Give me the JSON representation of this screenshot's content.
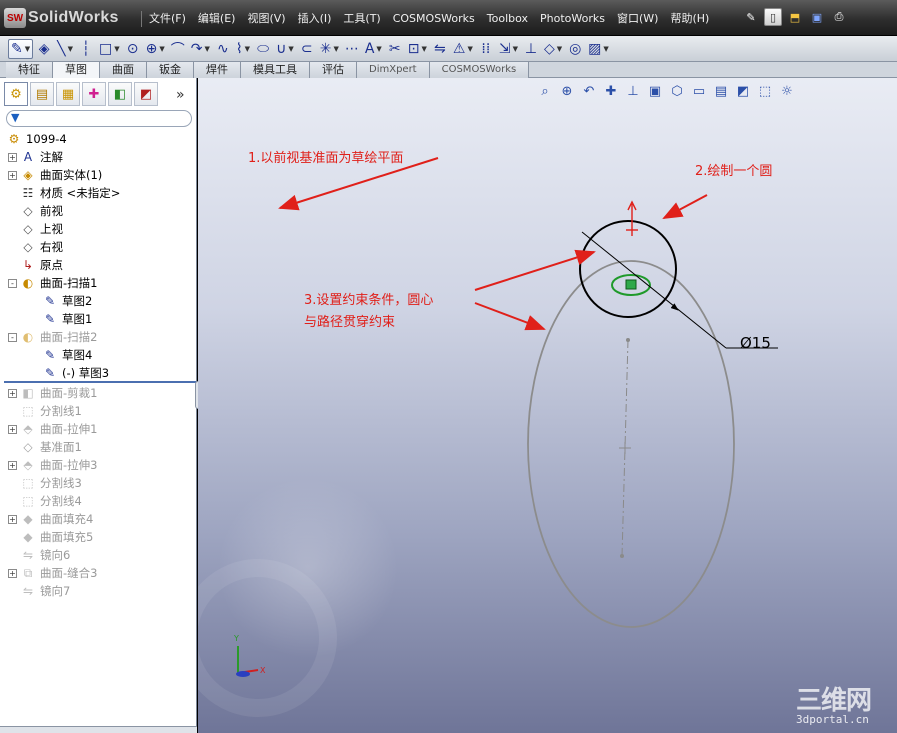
{
  "app": {
    "logo_badge": "SW",
    "name": "SolidWorks"
  },
  "menu": [
    "文件(F)",
    "编辑(E)",
    "视图(V)",
    "插入(I)",
    "工具(T)",
    "COSMOSWorks",
    "Toolbox",
    "PhotoWorks",
    "窗口(W)",
    "帮助(H)"
  ],
  "title_tools": [
    "pushpin-icon",
    "new-document-icon",
    "open-icon",
    "save-icon",
    "print-icon"
  ],
  "sketch_tools": [
    "sketch-icon",
    "smart-dimension-icon",
    "line-icon",
    "centerline-icon",
    "rectangle-icon",
    "circle-icon",
    "circle-perimeter-icon",
    "arc-icon",
    "tangent-arc-icon",
    "spline-icon",
    "convert-spline-icon",
    "ellipse-icon",
    "parabola-icon",
    "partial-ellipse-icon",
    "point-icon",
    "grid-icon",
    "text-icon",
    "trim-icon",
    "offset-icon",
    "mirror-icon",
    "warning-icon",
    "linear-pattern-icon",
    "move-entities-icon",
    "display-relations-icon",
    "repair-icon",
    "rapid-sketch-icon",
    "sketch-picture-icon"
  ],
  "tabs": [
    {
      "label": "特征",
      "active": false
    },
    {
      "label": "草图",
      "active": true
    },
    {
      "label": "曲面",
      "active": false
    },
    {
      "label": "钣金",
      "active": false
    },
    {
      "label": "焊件",
      "active": false
    },
    {
      "label": "模具工具",
      "active": false
    },
    {
      "label": "评估",
      "active": false
    },
    {
      "label": "DimXpert",
      "active": false
    },
    {
      "label": "COSMOSWorks",
      "active": false
    }
  ],
  "feature_manager": {
    "tool_icons": [
      "feature-manager-icon",
      "property-manager-icon",
      "configuration-manager-icon",
      "dimxpert-manager-icon",
      "display-manager-icon",
      "appearance-icon"
    ],
    "more": "»",
    "filter_icon": "filter-icon",
    "tree": [
      {
        "label": "1099-4",
        "icon": "part-icon",
        "indent": 0,
        "expand": "",
        "dim": false
      },
      {
        "label": "注解",
        "icon": "annotation-icon",
        "indent": 1,
        "expand": "+",
        "dim": false
      },
      {
        "label": "曲面实体(1)",
        "icon": "surface-bodies-icon",
        "indent": 1,
        "expand": "+",
        "dim": false
      },
      {
        "label": "材质 <未指定>",
        "icon": "material-icon",
        "indent": 1,
        "expand": "",
        "dim": false
      },
      {
        "label": "前视",
        "icon": "plane-icon",
        "indent": 1,
        "expand": "",
        "dim": false
      },
      {
        "label": "上视",
        "icon": "plane-icon",
        "indent": 1,
        "expand": "",
        "dim": false
      },
      {
        "label": "右视",
        "icon": "plane-icon",
        "indent": 1,
        "expand": "",
        "dim": false
      },
      {
        "label": "原点",
        "icon": "origin-icon",
        "indent": 1,
        "expand": "",
        "dim": false
      },
      {
        "label": "曲面-扫描1",
        "icon": "sweep-surface-icon",
        "indent": 1,
        "expand": "-",
        "dim": false
      },
      {
        "label": "草图2",
        "icon": "sketch-icon",
        "indent": 2,
        "expand": "",
        "dim": false
      },
      {
        "label": "草图1",
        "icon": "sketch-icon",
        "indent": 2,
        "expand": "",
        "dim": false
      },
      {
        "label": "曲面-扫描2",
        "icon": "sweep-surface-icon",
        "indent": 1,
        "expand": "-",
        "dim": true
      },
      {
        "label": "草图4",
        "icon": "sketch-icon",
        "indent": 2,
        "expand": "",
        "dim": false
      },
      {
        "label": "(-) 草图3",
        "icon": "sketch-icon",
        "indent": 2,
        "expand": "",
        "dim": false
      },
      {
        "label": "曲面-剪裁1",
        "icon": "trim-surface-icon",
        "indent": 1,
        "expand": "+",
        "dim": true
      },
      {
        "label": "分割线1",
        "icon": "split-line-icon",
        "indent": 1,
        "expand": "",
        "dim": true
      },
      {
        "label": "曲面-拉伸1",
        "icon": "extrude-surface-icon",
        "indent": 1,
        "expand": "+",
        "dim": true
      },
      {
        "label": "基准面1",
        "icon": "plane-icon",
        "indent": 1,
        "expand": "",
        "dim": true
      },
      {
        "label": "曲面-拉伸3",
        "icon": "extrude-surface-icon",
        "indent": 1,
        "expand": "+",
        "dim": true
      },
      {
        "label": "分割线3",
        "icon": "split-line-icon",
        "indent": 1,
        "expand": "",
        "dim": true
      },
      {
        "label": "分割线4",
        "icon": "split-line-icon",
        "indent": 1,
        "expand": "",
        "dim": true
      },
      {
        "label": "曲面填充4",
        "icon": "fill-surface-icon",
        "indent": 1,
        "expand": "+",
        "dim": true
      },
      {
        "label": "曲面填充5",
        "icon": "fill-surface-icon",
        "indent": 1,
        "expand": "",
        "dim": true
      },
      {
        "label": "镜向6",
        "icon": "mirror-icon",
        "indent": 1,
        "expand": "",
        "dim": true
      },
      {
        "label": "曲面-缝合3",
        "icon": "knit-surface-icon",
        "indent": 1,
        "expand": "+",
        "dim": true
      },
      {
        "label": "镜向7",
        "icon": "mirror-icon",
        "indent": 1,
        "expand": "",
        "dim": true
      }
    ]
  },
  "heads_up": [
    "zoom-to-fit-icon",
    "zoom-area-icon",
    "previous-view-icon",
    "section-view-icon",
    "view-orientation-icon",
    "display-style-icon",
    "hide-show-icon",
    "edit-appearance-icon",
    "apply-scene-icon",
    "view-settings-icon",
    "rendering-icon",
    "photoworks-icon"
  ],
  "annotations": {
    "a1": "1.以前视基准面为草绘平面",
    "a2": "2.绘制一个圆",
    "a3_line1": "3.设置约束条件，圆心",
    "a3_line2": "与路径贯穿约束",
    "dimension": "Ø15"
  },
  "colors": {
    "annotation_red": "#e0201a",
    "accent_blue": "#1b2f8f"
  },
  "triad": {
    "x": "X",
    "y": "Y"
  },
  "watermark": {
    "big": "三维网",
    "small": "3dportal.cn"
  }
}
